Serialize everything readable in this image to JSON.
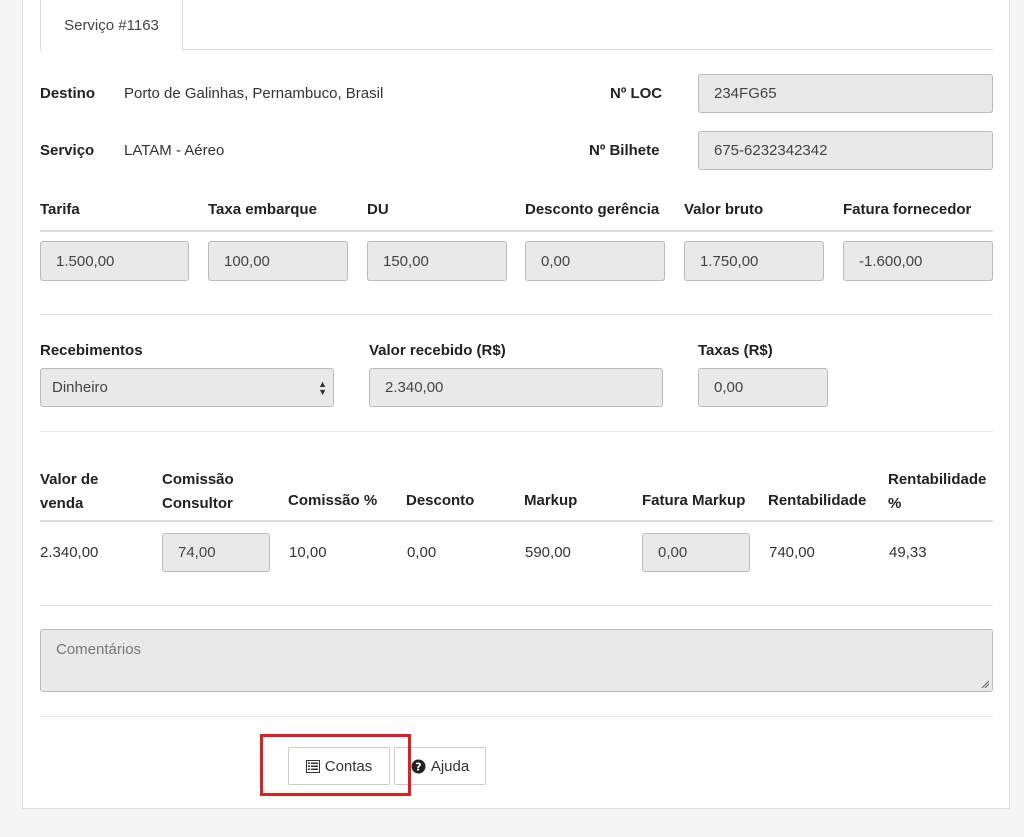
{
  "tab": {
    "label": "Serviço #1163"
  },
  "info": {
    "destino_label": "Destino",
    "destino_value": "Porto de Galinhas, Pernambuco, Brasil",
    "servico_label": "Serviço",
    "servico_value": "LATAM - Aéreo",
    "loc_label": "Nº LOC",
    "loc_value": "234FG65",
    "bilhete_label": "Nº Bilhete",
    "bilhete_value": "675-6232342342"
  },
  "tarifas": {
    "headers": [
      "Tarifa",
      "Taxa embarque",
      "DU",
      "Desconto gerência",
      "Valor bruto",
      "Fatura fornecedor"
    ],
    "values": [
      "1.500,00",
      "100,00",
      "150,00",
      "0,00",
      "1.750,00",
      "-1.600,00"
    ]
  },
  "recebimentos": {
    "label": "Recebimentos",
    "selected": "Dinheiro",
    "valor_label": "Valor recebido (R$)",
    "valor_value": "2.340,00",
    "taxas_label": "Taxas (R$)",
    "taxas_value": "0,00"
  },
  "resumo": {
    "headers": [
      [
        "Valor de",
        "venda"
      ],
      [
        "Comissão",
        "Consultor"
      ],
      [
        "Comissão %"
      ],
      [
        "Desconto"
      ],
      [
        "Markup"
      ],
      [
        "Fatura Markup"
      ],
      [
        "Rentabilidade"
      ],
      [
        "Rentabilidade",
        "%"
      ]
    ],
    "values": [
      "2.340,00",
      "74,00",
      "10,00",
      "0,00",
      "590,00",
      "0,00",
      "740,00",
      "49,33"
    ]
  },
  "comentarios": {
    "placeholder": "Comentários"
  },
  "buttons": {
    "contas": "Contas",
    "ajuda": "Ajuda"
  },
  "colors": {
    "highlight": "#e02020",
    "field_bg": "#e9e9e9"
  },
  "icons": {
    "contas": "list-icon",
    "ajuda": "question-circle-icon"
  }
}
